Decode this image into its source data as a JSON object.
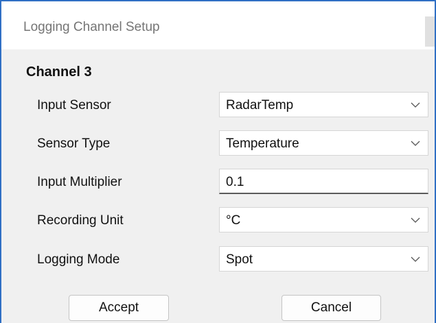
{
  "window": {
    "title": "Logging Channel Setup"
  },
  "channel": {
    "title": "Channel 3"
  },
  "fields": {
    "input_sensor": {
      "label": "Input Sensor",
      "value": "RadarTemp"
    },
    "sensor_type": {
      "label": "Sensor Type",
      "value": "Temperature"
    },
    "input_multiplier": {
      "label": "Input Multiplier",
      "value": "0.1"
    },
    "recording_unit": {
      "label": "Recording Unit",
      "value": "°C"
    },
    "logging_mode": {
      "label": "Logging Mode",
      "value": "Spot"
    }
  },
  "buttons": {
    "accept": "Accept",
    "cancel": "Cancel"
  },
  "icons": {
    "dropdown": "chevron-down-icon"
  },
  "colors": {
    "window_border": "#2f6fc4",
    "background": "#f0f0f0"
  }
}
